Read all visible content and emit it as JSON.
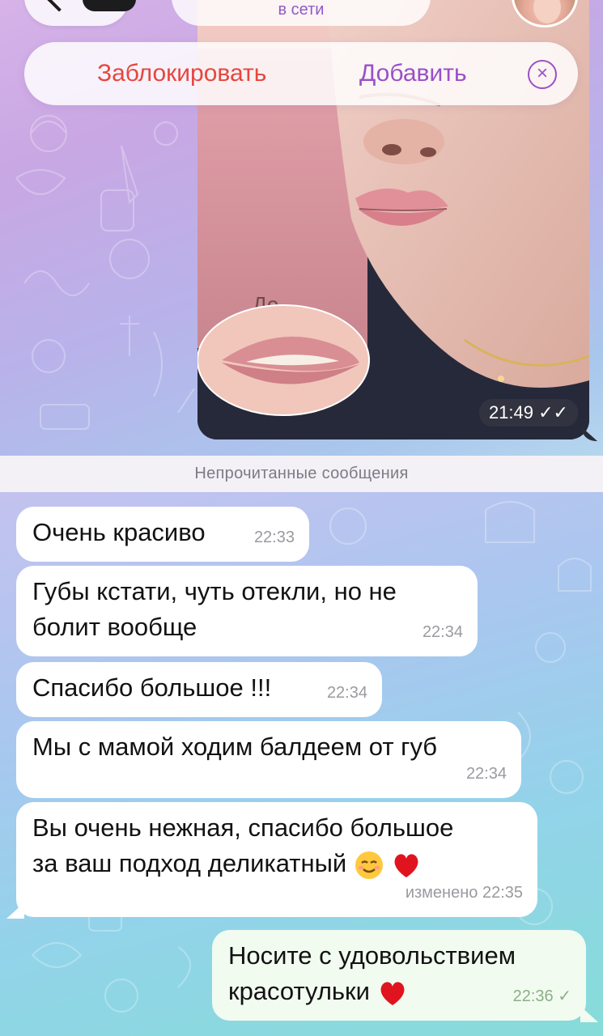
{
  "header": {
    "status": "в сети"
  },
  "action_bar": {
    "block_label": "Заблокировать",
    "add_label": "Добавить",
    "close_icon": "close-circle-icon"
  },
  "photo_message": {
    "overlay_text": "До",
    "time": "21:49",
    "read_status": "double-check-icon"
  },
  "unread_divider": "Непрочитанные сообщения",
  "messages": [
    {
      "text": "Очень красиво",
      "time": "22:33"
    },
    {
      "line1": "Губы кстати, чуть отекли, но не",
      "line2": "болит вообще",
      "time": "22:34"
    },
    {
      "text": "Спасибо большое !!!",
      "time": "22:34"
    },
    {
      "text": "Мы с мамой ходим балдеем от губ",
      "time": "22:34"
    },
    {
      "line1": "Вы очень нежная, спасибо большое",
      "line2": "за ваш подход деликатный",
      "emojis": [
        "relieved-face",
        "red-heart"
      ],
      "time": "изменено 22:35"
    }
  ],
  "outgoing": {
    "line1": "Носите с удовольствием",
    "line2": "красотульки",
    "emoji": "red-heart",
    "time": "22:36",
    "status": "check-icon"
  },
  "colors": {
    "block": "#e5473f",
    "accent": "#9a50c7",
    "outgoing_bubble": "#f2fbf0"
  }
}
